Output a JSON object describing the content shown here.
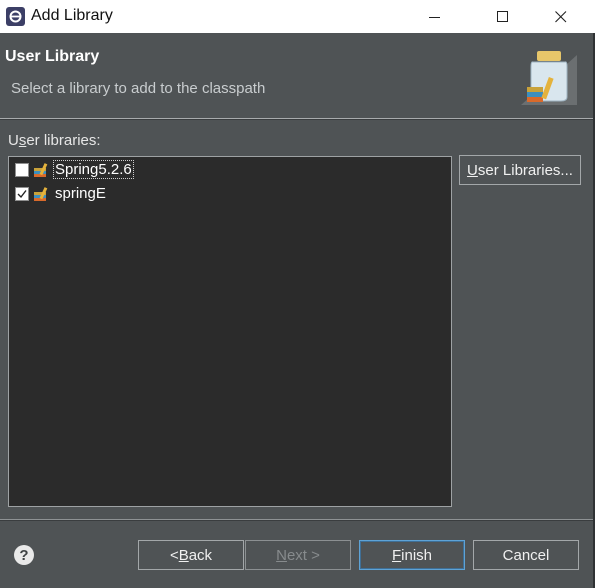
{
  "window": {
    "title": "Add Library",
    "icon": "eclipse-icon",
    "controls": [
      "minimize-icon",
      "maximize-icon",
      "close-icon"
    ]
  },
  "banner": {
    "title": "User Library",
    "description": "Select a library to add to the classpath",
    "graphic": "library-jar-icon"
  },
  "libraries": {
    "label_pre": "U",
    "label_mnemonic": "s",
    "label_post": "er libraries:",
    "items": [
      {
        "label": "Spring5.2.6",
        "checked": false,
        "icon": "library-icon"
      },
      {
        "label": "springE",
        "checked": true,
        "icon": "library-icon"
      }
    ],
    "manage_button": {
      "mnemonic": "U",
      "rest": "ser Libraries..."
    }
  },
  "footer": {
    "help_icon": "help-icon",
    "help_glyph": "?",
    "back": {
      "pre": "< ",
      "mnemonic": "B",
      "rest": "ack"
    },
    "next": {
      "pre": "",
      "mnemonic": "N",
      "rest": "ext >"
    },
    "finish": {
      "pre": "",
      "mnemonic": "F",
      "rest": "inish"
    },
    "cancel": {
      "label": "Cancel"
    }
  },
  "colors": {
    "background": "#4f5355",
    "list_background": "#2b2b2b",
    "titlebar": "#ffffff",
    "default_button_border": "#5ea3d6"
  }
}
